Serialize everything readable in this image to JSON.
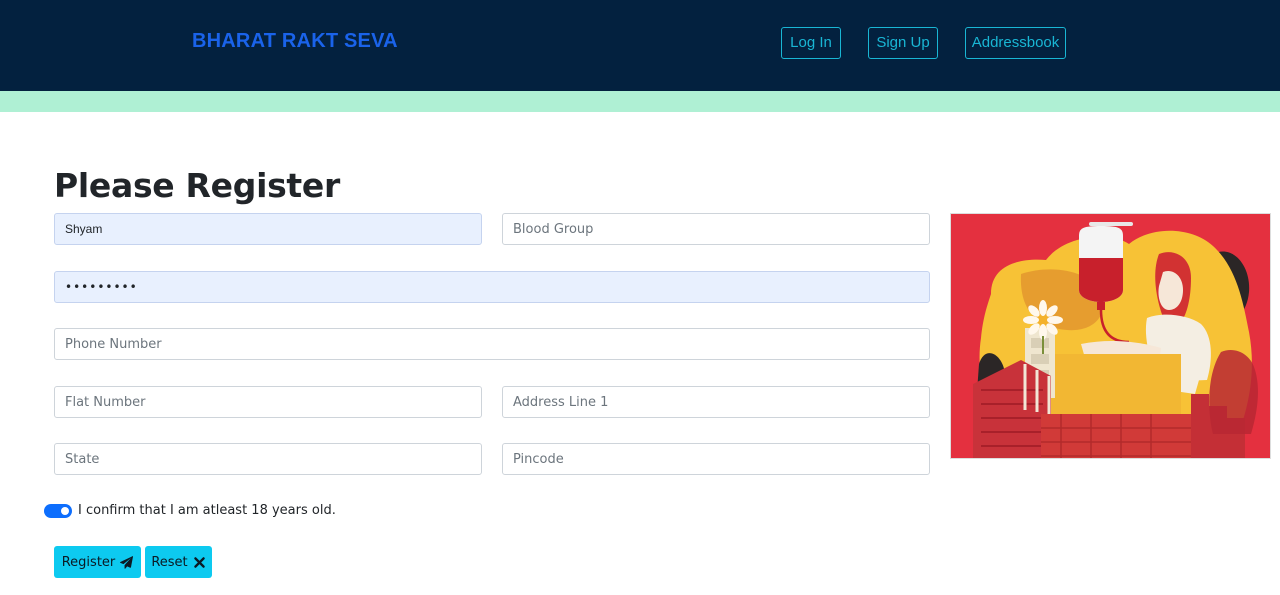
{
  "header": {
    "brand": "BHARAT RAKT SEVA",
    "nav": {
      "login": "Log In",
      "signup": "Sign Up",
      "addressbook": "Addressbook"
    }
  },
  "form": {
    "title": "Please Register",
    "name": {
      "value": "Shyam"
    },
    "blood_group": {
      "placeholder": "Blood Group"
    },
    "password": {
      "value": "123456789"
    },
    "phone": {
      "placeholder": "Phone Number"
    },
    "flat": {
      "placeholder": "Flat Number"
    },
    "address_line_1": {
      "placeholder": "Address Line 1"
    },
    "state": {
      "placeholder": "State"
    },
    "pincode": {
      "placeholder": "Pincode"
    },
    "age_confirm": {
      "label": "I confirm that I am atleast 18 years old.",
      "checked": true
    },
    "register_label": "Register",
    "reset_label": "Reset",
    "register_icon": "paper-plane-icon",
    "reset_icon": "x-mark-icon"
  },
  "colors": {
    "navbar": "#03213f",
    "brand": "#1a63ea",
    "nav_button": "#19b6d4",
    "strip": "#aff0d4",
    "button": "#0dcaf0",
    "toggle": "#0d6efd",
    "illustration_bg": "#e4303f"
  }
}
